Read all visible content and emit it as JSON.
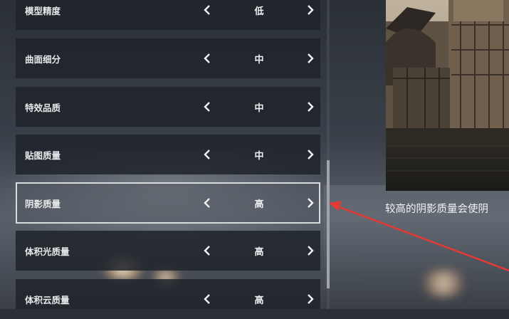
{
  "settings": [
    {
      "label": "模型精度",
      "value": "低"
    },
    {
      "label": "曲面细分",
      "value": "中"
    },
    {
      "label": "特效品质",
      "value": "中"
    },
    {
      "label": "贴图质量",
      "value": "中"
    },
    {
      "label": "阴影质量",
      "value": "高"
    },
    {
      "label": "体积光质量",
      "value": "高"
    },
    {
      "label": "体积云质量",
      "value": "高"
    }
  ],
  "selected_index": 4,
  "preview": {
    "description": "较高的阴影质量会使阴"
  },
  "colors": {
    "row_bg": "#20242b",
    "selected_border": "#d9dcdf",
    "annotation_arrow": "#e53935"
  },
  "icons": {
    "decrease": "chevron-left-icon",
    "increase": "chevron-right-icon"
  },
  "scrollbar": {
    "visible_fraction": 0.41
  }
}
